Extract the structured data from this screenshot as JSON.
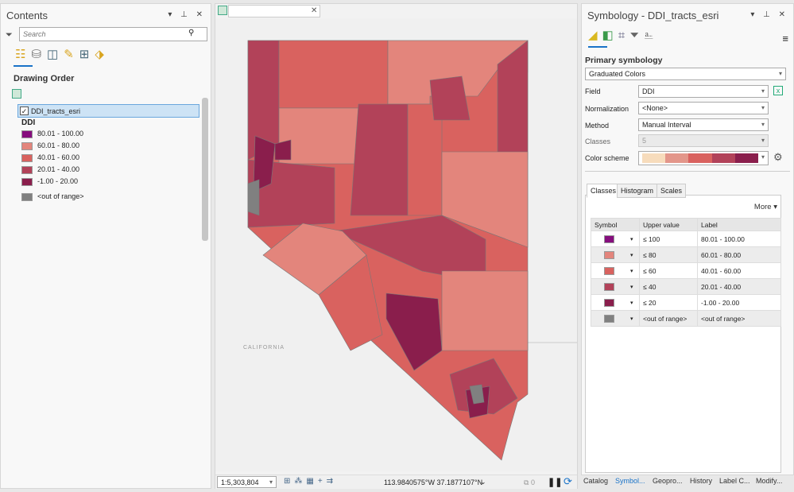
{
  "contents": {
    "title": "Contents",
    "search_placeholder": "Search",
    "section": "Drawing Order",
    "layer": "DDI_tracts_esri",
    "field": "DDI",
    "legend": [
      {
        "label": "80.01 - 100.00",
        "color": "#860e7e"
      },
      {
        "label": "60.01 - 80.00",
        "color": "#e3857c"
      },
      {
        "label": "40.01 - 60.00",
        "color": "#d9625f"
      },
      {
        "label": "20.01 - 40.00",
        "color": "#b24259"
      },
      {
        "label": "-1.00 - 20.00",
        "color": "#8a1e4c"
      },
      {
        "label": "<out of range>",
        "color": "#808080"
      }
    ]
  },
  "map": {
    "place_label": "CALIFORNIA",
    "scale": "1:5,303,804",
    "coords": "113.9840575°W 37.1877107°N",
    "selected_count": "0"
  },
  "symbology": {
    "title": "Symbology - DDI_tracts_esri",
    "primary": "Primary symbology",
    "renderer": "Graduated Colors",
    "field_label": "Field",
    "field_value": "DDI",
    "norm_label": "Normalization",
    "norm_value": "<None>",
    "method_label": "Method",
    "method_value": "Manual Interval",
    "classes_label": "Classes",
    "classes_value": "5",
    "scheme_label": "Color scheme",
    "scheme_colors": [
      "#f7dcbc",
      "#e3968a",
      "#d9625f",
      "#b24259",
      "#8a1e4c"
    ],
    "tabs": [
      "Classes",
      "Histogram",
      "Scales"
    ],
    "more": "More",
    "headers": [
      "Symbol",
      "Upper value",
      "Label"
    ],
    "rows": [
      {
        "upper": "≤  100",
        "label": "80.01 - 100.00",
        "color": "#860e7e"
      },
      {
        "upper": "≤  80",
        "label": "60.01 - 80.00",
        "color": "#e3857c"
      },
      {
        "upper": "≤  60",
        "label": "40.01 - 60.00",
        "color": "#d9625f"
      },
      {
        "upper": "≤  40",
        "label": "20.01 - 40.00",
        "color": "#b24259"
      },
      {
        "upper": "≤  20",
        "label": "-1.00 - 20.00",
        "color": "#8a1e4c"
      },
      {
        "upper": "<out of range>",
        "label": "<out of range>",
        "color": "#808080"
      }
    ]
  },
  "bottom_tabs": [
    "Catalog",
    "Symbol...",
    "Geopro...",
    "History",
    "Label C...",
    "Modify..."
  ]
}
